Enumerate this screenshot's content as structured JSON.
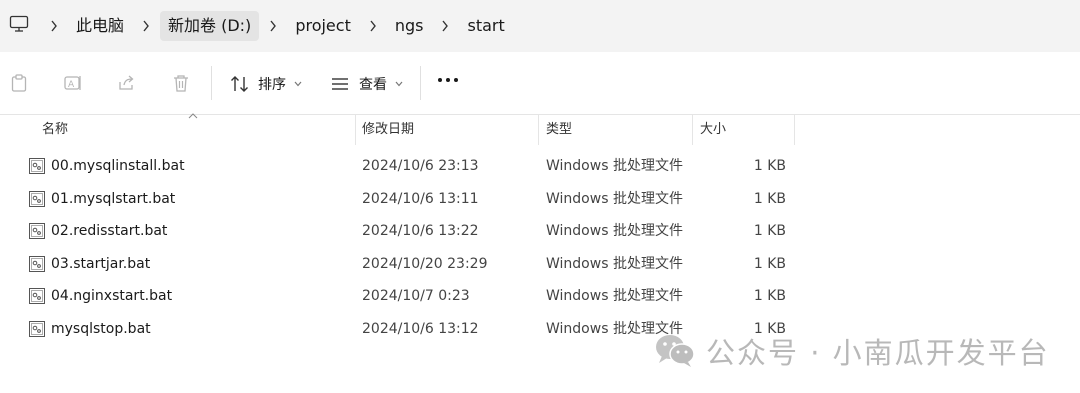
{
  "address_bar": {
    "crumbs": [
      "此电脑",
      "新加卷 (D:)",
      "project",
      "ngs",
      "start"
    ]
  },
  "toolbar": {
    "sort_label": "排序",
    "view_label": "查看"
  },
  "columns": {
    "name": "名称",
    "date": "修改日期",
    "type": "类型",
    "size": "大小"
  },
  "files": [
    {
      "name": "00.mysqlinstall.bat",
      "date": "2024/10/6 23:13",
      "type": "Windows 批处理文件",
      "size": "1 KB"
    },
    {
      "name": "01.mysqlstart.bat",
      "date": "2024/10/6 13:11",
      "type": "Windows 批处理文件",
      "size": "1 KB"
    },
    {
      "name": "02.redisstart.bat",
      "date": "2024/10/6 13:22",
      "type": "Windows 批处理文件",
      "size": "1 KB"
    },
    {
      "name": "03.startjar.bat",
      "date": "2024/10/20 23:29",
      "type": "Windows 批处理文件",
      "size": "1 KB"
    },
    {
      "name": "04.nginxstart.bat",
      "date": "2024/10/7 0:23",
      "type": "Windows 批处理文件",
      "size": "1 KB"
    },
    {
      "name": "mysqlstop.bat",
      "date": "2024/10/6 13:12",
      "type": "Windows 批处理文件",
      "size": "1 KB"
    }
  ],
  "watermark": {
    "text": "公众号 · 小南瓜开发平台"
  }
}
